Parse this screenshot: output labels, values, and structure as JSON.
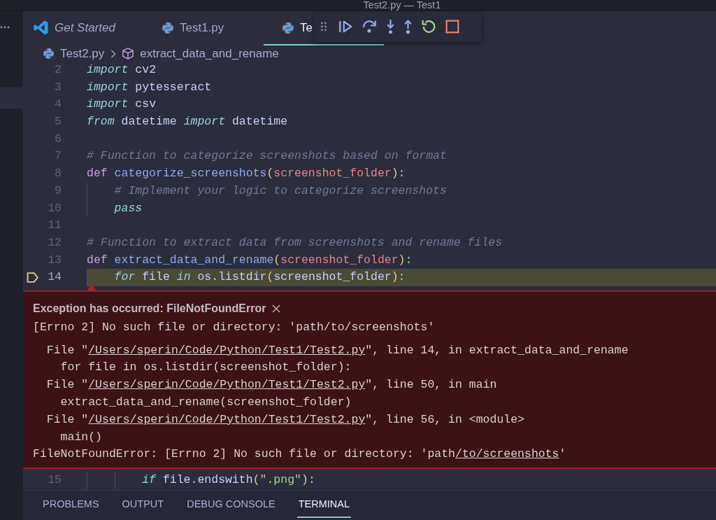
{
  "window": {
    "title": "Test2.py — Test1"
  },
  "tabs": [
    {
      "label": "Get Started",
      "kind": "welcome",
      "selected": false
    },
    {
      "label": "Test1.py",
      "kind": "python",
      "selected": false
    },
    {
      "label": "Te",
      "kind": "python",
      "selected": true
    }
  ],
  "breadcrumb": [
    {
      "label": "Test2.py",
      "kind": "file"
    },
    {
      "label": "extract_data_and_rename",
      "kind": "symbol"
    }
  ],
  "editor": {
    "lines": [
      {
        "number": "2",
        "current": false,
        "tokens": [
          {
            "kind": "keyword",
            "text": "import"
          },
          {
            "kind": "plain",
            "text": " cv2"
          }
        ]
      },
      {
        "number": "3",
        "current": false,
        "tokens": [
          {
            "kind": "keyword",
            "text": "import"
          },
          {
            "kind": "plain",
            "text": " pytesseract"
          }
        ]
      },
      {
        "number": "4",
        "current": false,
        "tokens": [
          {
            "kind": "keyword",
            "text": "import"
          },
          {
            "kind": "plain",
            "text": " csv"
          }
        ]
      },
      {
        "number": "5",
        "current": false,
        "tokens": [
          {
            "kind": "keyword",
            "text": "from"
          },
          {
            "kind": "plain",
            "text": " datetime "
          },
          {
            "kind": "keyword",
            "text": "import"
          },
          {
            "kind": "plain",
            "text": " datetime"
          }
        ]
      },
      {
        "number": "6",
        "current": false
      },
      {
        "number": "7",
        "current": false,
        "tokens": [
          {
            "kind": "comment",
            "text": "# Function to categorize screenshots based on format"
          }
        ]
      },
      {
        "number": "8",
        "current": false,
        "tokens": [
          {
            "kind": "def",
            "text": "def "
          },
          {
            "kind": "function",
            "text": "categorize_screenshots"
          },
          {
            "kind": "paren",
            "text": "("
          },
          {
            "kind": "param",
            "text": "screenshot_folder"
          },
          {
            "kind": "paren",
            "text": ")"
          },
          {
            "kind": "punct",
            "text": ":"
          }
        ],
        "children": [
          {
            "number": "9",
            "current": false,
            "tokens": [
              {
                "kind": "comment",
                "text": "# Implement your logic to categorize screenshots"
              }
            ]
          },
          {
            "number": "10",
            "current": false,
            "tokens": [
              {
                "kind": "keyword",
                "text": "pass"
              }
            ]
          }
        ]
      },
      {
        "number": "11",
        "current": false
      },
      {
        "number": "12",
        "current": false,
        "tokens": [
          {
            "kind": "comment",
            "text": "# Function to extract data from screenshots and rename files"
          }
        ]
      },
      {
        "number": "13",
        "current": false,
        "tokens": [
          {
            "kind": "def",
            "text": "def "
          },
          {
            "kind": "function",
            "text": "extract_data_and_rename"
          },
          {
            "kind": "paren",
            "text": "("
          },
          {
            "kind": "param",
            "text": "screenshot_folder"
          },
          {
            "kind": "paren",
            "text": ")"
          },
          {
            "kind": "punct",
            "text": ":"
          }
        ],
        "children": [
          {
            "number": "14",
            "current": true,
            "tokens": [
              {
                "kind": "keyword",
                "text": "for"
              },
              {
                "kind": "plain",
                "text": " file "
              },
              {
                "kind": "keyword",
                "text": "in"
              },
              {
                "kind": "plain",
                "text": " os.listdir"
              },
              {
                "kind": "paren",
                "text": "("
              },
              {
                "kind": "plain",
                "text": "screenshot_folder"
              },
              {
                "kind": "paren",
                "text": ")"
              },
              {
                "kind": "punct",
                "text": ":"
              }
            ],
            "children": [
              {
                "number": "15",
                "current": false,
                "tokens": [
                  {
                    "kind": "keyword",
                    "text": "if"
                  },
                  {
                    "kind": "plain",
                    "text": " file.endswith"
                  },
                  {
                    "kind": "paren",
                    "text": "("
                  },
                  {
                    "kind": "string",
                    "text": "\".png\""
                  },
                  {
                    "kind": "paren",
                    "text": ")"
                  },
                  {
                    "kind": "punct",
                    "text": ":"
                  }
                ]
              }
            ]
          }
        ]
      }
    ],
    "exception": {
      "title": "Exception has occurred: FileNotFoundError",
      "message": "[Errno 2] No such file or directory: 'path/to/screenshots'",
      "traceback": [
        {
          "prefix": "File \"",
          "path": "/Users/sperin/Code/Python/Test1/Test2.py",
          "suffix": "\", line 14, in extract_data_and_rename",
          "source": "for file in os.listdir(screenshot_folder):"
        },
        {
          "prefix": "File \"",
          "path": "/Users/sperin/Code/Python/Test1/Test2.py",
          "suffix": "\", line 50, in main",
          "source": "extract_data_and_rename(screenshot_folder)"
        },
        {
          "prefix": "File \"",
          "path": "/Users/sperin/Code/Python/Test1/Test2.py",
          "suffix": "\", line 56, in <module>",
          "source": "main()"
        }
      ],
      "summary": {
        "prefix": "FileNotFoundError: [Errno 2] No such file or directory: 'path",
        "link": "/to/screenshots",
        "suffix": "'"
      }
    }
  },
  "panel": {
    "tabs": [
      {
        "label": "PROBLEMS",
        "selected": false
      },
      {
        "label": "OUTPUT",
        "selected": false
      },
      {
        "label": "DEBUG CONSOLE",
        "selected": false
      },
      {
        "label": "TERMINAL",
        "selected": true
      }
    ]
  }
}
